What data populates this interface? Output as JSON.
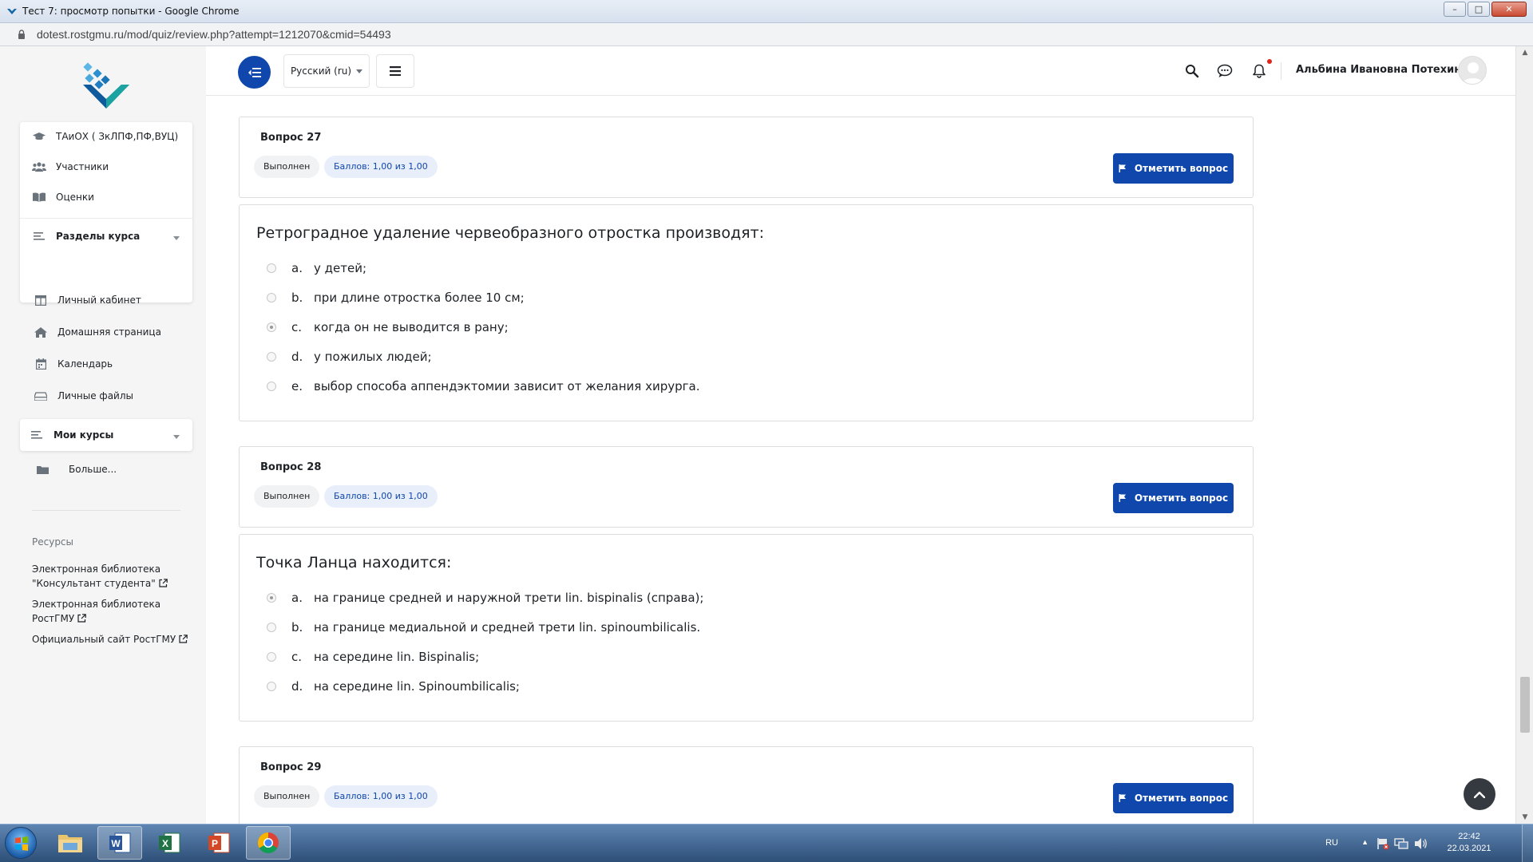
{
  "window": {
    "title": "Тест 7: просмотр попытки - Google Chrome",
    "url": "dotest.rostgmu.ru/mod/quiz/review.php?attempt=1212070&cmid=54493"
  },
  "sidebar": {
    "course_items": [
      {
        "label": "ТАиОХ ( ЗкЛПФ,ПФ,ВУЦ)",
        "icon": "graduation-cap-icon"
      },
      {
        "label": "Участники",
        "icon": "users-icon"
      },
      {
        "label": "Оценки",
        "icon": "book-icon"
      }
    ],
    "sections_label": "Разделы курса",
    "nav_items": [
      {
        "label": "Личный кабинет",
        "icon": "dashboard-icon"
      },
      {
        "label": "Домашняя страница",
        "icon": "home-icon"
      },
      {
        "label": "Календарь",
        "icon": "calendar-icon"
      },
      {
        "label": "Личные файлы",
        "icon": "files-icon"
      }
    ],
    "my_courses_label": "Мои курсы",
    "more_label": "Больше...",
    "resources_title": "Ресурсы",
    "resources": [
      {
        "line1": "Электронная библиотека",
        "line2": "\"Консультант студента\""
      },
      {
        "line1": "Электронная библиотека",
        "line2": "РостГМУ"
      },
      {
        "line1": "Официальный сайт РостГМУ",
        "line2": ""
      }
    ]
  },
  "topnav": {
    "language": "Русский (ru)",
    "user_name": "Альбина Ивановна Потехина"
  },
  "questions": [
    {
      "number": "Вопрос 27",
      "state": "Выполнен",
      "grade": "Баллов: 1,00 из 1,00",
      "flag_label": "Отметить вопрос",
      "text": "Ретроградное удаление червеобразного отростка производят:",
      "answers": [
        {
          "letter": "a.",
          "text": "у детей;",
          "checked": false
        },
        {
          "letter": "b.",
          "text": "при длине отростка более 10 см;",
          "checked": false
        },
        {
          "letter": "c.",
          "text": "когда он не выводится в рану;",
          "checked": true
        },
        {
          "letter": "d.",
          "text": "у пожилых людей;",
          "checked": false
        },
        {
          "letter": "e.",
          "text": "выбор способа аппендэктомии зависит от желания хирурга.",
          "checked": false
        }
      ]
    },
    {
      "number": "Вопрос 28",
      "state": "Выполнен",
      "grade": "Баллов: 1,00 из 1,00",
      "flag_label": "Отметить вопрос",
      "text": "Точка Ланца находится:",
      "answers": [
        {
          "letter": "a.",
          "text": "на границе средней и наружной трети lin. bispinalis (справа);",
          "checked": true
        },
        {
          "letter": "b.",
          "text": "на границе медиальной и средней трети lin. spinoumbilicalis.",
          "checked": false
        },
        {
          "letter": "c.",
          "text": "на середине lin. Bispinalis;",
          "checked": false
        },
        {
          "letter": "d.",
          "text": "на середине lin. Spinoumbilicalis;",
          "checked": false
        }
      ]
    },
    {
      "number": "Вопрос 29",
      "state": "Выполнен",
      "grade": "Баллов: 1,00 из 1,00",
      "flag_label": "Отметить вопрос"
    }
  ],
  "taskbar": {
    "apps": [
      "explorer-icon",
      "word-icon",
      "excel-icon",
      "powerpoint-icon",
      "chrome-icon"
    ],
    "tray_lang": "RU",
    "time": "22:42",
    "date": "22.03.2021"
  },
  "colors": {
    "primary": "#0f47ad",
    "sidebar_bg": "#f5f5f5",
    "notification": "#e0261b"
  }
}
